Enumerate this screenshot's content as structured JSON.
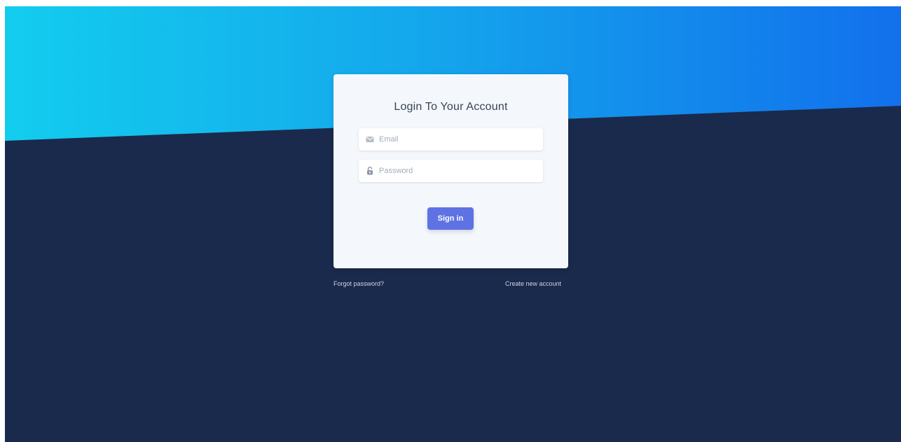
{
  "login_card": {
    "title": "Login To Your Account",
    "email": {
      "placeholder": "Email",
      "value": "",
      "icon": "envelope-icon"
    },
    "password": {
      "placeholder": "Password",
      "value": "",
      "icon": "lock-icon"
    },
    "submit_label": "Sign in"
  },
  "footer_links": {
    "forgot_password": "Forgot password?",
    "create_account": "Create new account"
  },
  "colors": {
    "background": "#1a2a4c",
    "gradient_start": "#13cdee",
    "gradient_end": "#1270ec",
    "primary_button": "#5e72e4",
    "card": "#f4f7fb"
  }
}
